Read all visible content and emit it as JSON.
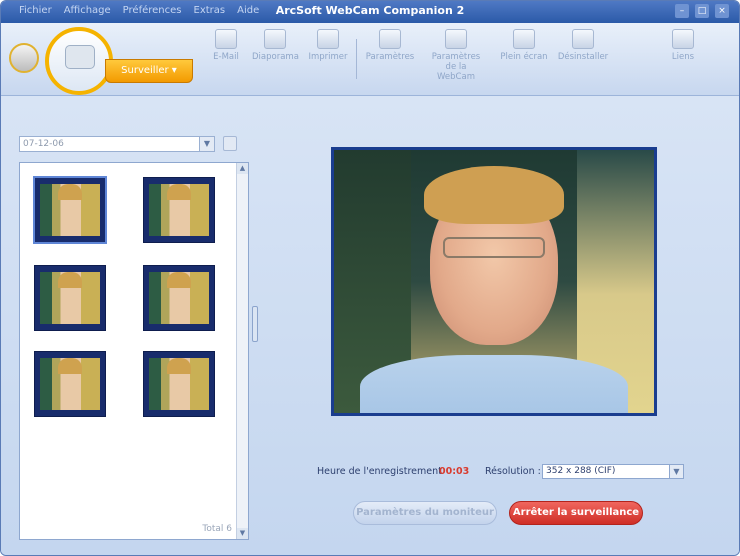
{
  "app": {
    "title": "ArcSoft WebCam Companion 2",
    "menu": [
      "Fichier",
      "Affichage",
      "Préférences",
      "Extras",
      "Aide"
    ],
    "window_buttons": [
      "–",
      "□",
      "×"
    ]
  },
  "toolbar": {
    "mode_label": "Surveiller ▾",
    "items": [
      {
        "label": "E-Mail",
        "icon": "email-icon"
      },
      {
        "label": "Diaporama",
        "icon": "slideshow-icon"
      },
      {
        "label": "Imprimer",
        "icon": "print-icon"
      },
      {
        "label": "Paramètres",
        "icon": "settings-icon"
      },
      {
        "label": "Paramètres de la WebCam",
        "icon": "webcam-settings-icon"
      },
      {
        "label": "Plein écran",
        "icon": "fullscreen-icon"
      },
      {
        "label": "Désinstaller",
        "icon": "uninstall-icon"
      },
      {
        "label": "Liens",
        "icon": "links-icon"
      }
    ]
  },
  "sidebar": {
    "date_value": "07-12-06",
    "total_label": "Total 6",
    "thumbnail_count": 6
  },
  "main": {
    "recording_time_label": "Heure de l'enregistrement",
    "recording_time_value": "00:03",
    "resolution_label": "Résolution :",
    "resolution_value": "352 x 288 (CIF)",
    "monitor_settings_button": "Paramètres du moniteur",
    "stop_button": "Arrêter la surveillance"
  },
  "colors": {
    "accent_orange": "#f39a00",
    "stop_red": "#cf2e26",
    "time_red": "#d93b2e",
    "frame_blue": "#1a3d8f"
  }
}
